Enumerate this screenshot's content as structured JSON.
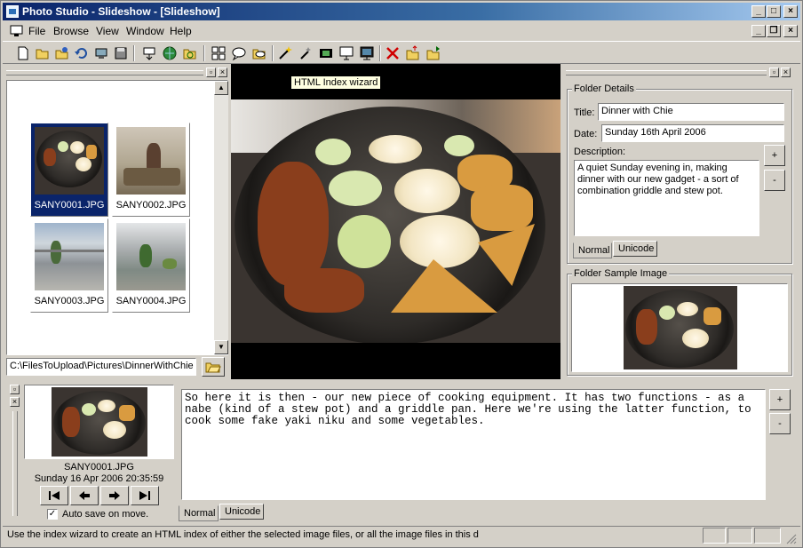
{
  "window": {
    "title": "Photo Studio - Slideshow - [Slideshow]"
  },
  "menu": [
    "File",
    "Browse",
    "View",
    "Window",
    "Help"
  ],
  "tooltip": "HTML Index wizard",
  "thumbnails": [
    {
      "name": "SANY0001.JPG",
      "selected": true
    },
    {
      "name": "SANY0002.JPG",
      "selected": false
    },
    {
      "name": "SANY0003.JPG",
      "selected": false
    },
    {
      "name": "SANY0004.JPG",
      "selected": false
    }
  ],
  "path_field": "C:\\FilesToUpload\\Pictures\\DinnerWithChie",
  "folder_details": {
    "group_label": "Folder Details",
    "title_label": "Title:",
    "title_value": "Dinner with Chie",
    "date_label": "Date:",
    "date_value": "Sunday 16th April 2006",
    "description_label": "Description:",
    "description_value": "A quiet Sunday evening in, making dinner with our new gadget - a sort of combination griddle and stew pot.",
    "plus": "+",
    "minus": "-",
    "tabs": [
      "Normal",
      "Unicode"
    ]
  },
  "folder_sample": {
    "group_label": "Folder Sample Image"
  },
  "current_image": {
    "filename": "SANY0001.JPG",
    "datetime": "Sunday 16 Apr 2006 20:35:59",
    "autosave_label": "Auto save on move.",
    "autosave_checked": true
  },
  "caption": {
    "text": "So here it is then - our new piece of cooking equipment. It has two functions - as a nabe (kind of a stew pot) and a griddle pan. Here we're using the latter function, to cook some fake yaki niku and some vegetables.",
    "plus": "+",
    "minus": "-",
    "tabs": [
      "Normal",
      "Unicode"
    ]
  },
  "status": {
    "text": "Use the index wizard to create an HTML index of either the selected image files, or all the image files in this d"
  },
  "colors": {
    "title_gradient_start": "#0a246a",
    "title_gradient_end": "#a6caf0",
    "selection": "#0a246a",
    "chrome": "#d4d0c8"
  }
}
